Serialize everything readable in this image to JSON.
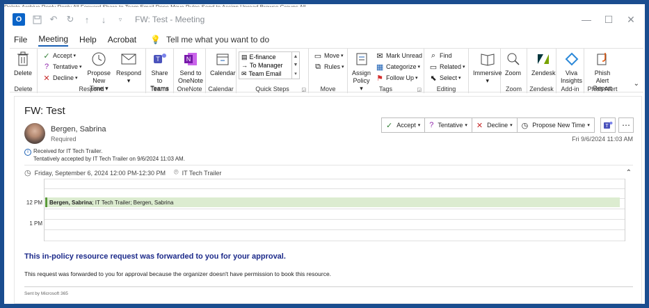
{
  "top_strip": "Delete  Archive  Reply  Reply All  Forward  Share to  Team Email  Done  Move  Rules  Send to  Assign  Unread  Browse Groups  All",
  "window": {
    "app_icon": "outlook-icon",
    "title": "FW: Test - Meeting",
    "controls": [
      "minimize-icon",
      "maximize-icon",
      "close-icon"
    ]
  },
  "menu": {
    "items": [
      "File",
      "Meeting",
      "Help",
      "Acrobat"
    ],
    "active": "Meeting",
    "tell_me": "Tell me what you want to do"
  },
  "ribbon": {
    "delete": {
      "button": "Delete",
      "group": "Delete"
    },
    "respond": {
      "accept": "Accept",
      "tentative": "Tentative",
      "decline": "Decline",
      "propose_line1": "Propose",
      "propose_line2": "New Time",
      "respond": "Respond",
      "group": "Respond"
    },
    "teams": {
      "line1": "Share to",
      "line2": "Teams",
      "group": "Teams"
    },
    "onenote": {
      "line1": "Send to",
      "line2": "OneNote",
      "group": "OneNote"
    },
    "calendar": {
      "button": "Calendar",
      "group": "Calendar"
    },
    "quick_steps": {
      "items": [
        "E-finance",
        "To Manager",
        "Team Email"
      ],
      "group": "Quick Steps"
    },
    "move": {
      "move": "Move",
      "rules": "Rules",
      "group": "Move"
    },
    "tags": {
      "assign_line1": "Assign",
      "assign_line2": "Policy",
      "mark_unread": "Mark Unread",
      "categorize": "Categorize",
      "follow_up": "Follow Up",
      "group": "Tags"
    },
    "editing": {
      "find": "Find",
      "related": "Related",
      "select": "Select",
      "group": "Editing"
    },
    "immersive": {
      "button": "Immersive",
      "group": ""
    },
    "zoom": {
      "button": "Zoom",
      "group": "Zoom"
    },
    "zendesk": {
      "button": "Zendesk",
      "group": "Zendesk"
    },
    "viva": {
      "line1": "Viva",
      "line2": "Insights",
      "group": "Add-in"
    },
    "phish": {
      "line1": "Phish Alert",
      "line2": "Report",
      "group": "Phish Alert"
    }
  },
  "message": {
    "subject": "FW: Test",
    "sender": "Bergen, Sabrina",
    "attendance": "Required",
    "response_buttons": {
      "accept": "Accept",
      "tentative": "Tentative",
      "decline": "Decline",
      "propose": "Propose New Time"
    },
    "sent_date": "Fri 9/6/2024 11:03 AM",
    "info_line1": "Received for IT Tech Trailer.",
    "info_line2": "Tentatively accepted by IT Tech Trailer on 9/6/2024 11:03 AM.",
    "when": "Friday, September 6, 2024 12:00 PM-12:30 PM",
    "location": "IT Tech Trailer",
    "calendar": {
      "hours": [
        "12 PM",
        "1 PM"
      ],
      "appointment_bold": "Bergen, Sabrina",
      "appointment_rest": " ; IT Tech Trailer; Bergen, Sabrina"
    },
    "headline": "This in-policy resource request was forwarded to you for your approval.",
    "body": "This request was forwarded to you for approval because the organizer doesn't have permission to book this resource.",
    "sent_by": "Sent by Microsoft 365"
  },
  "colors": {
    "frame": "#1a4d8f",
    "accent": "#1a5fb4",
    "headline": "#1c2a8a",
    "appointment": "#dcecd0"
  }
}
